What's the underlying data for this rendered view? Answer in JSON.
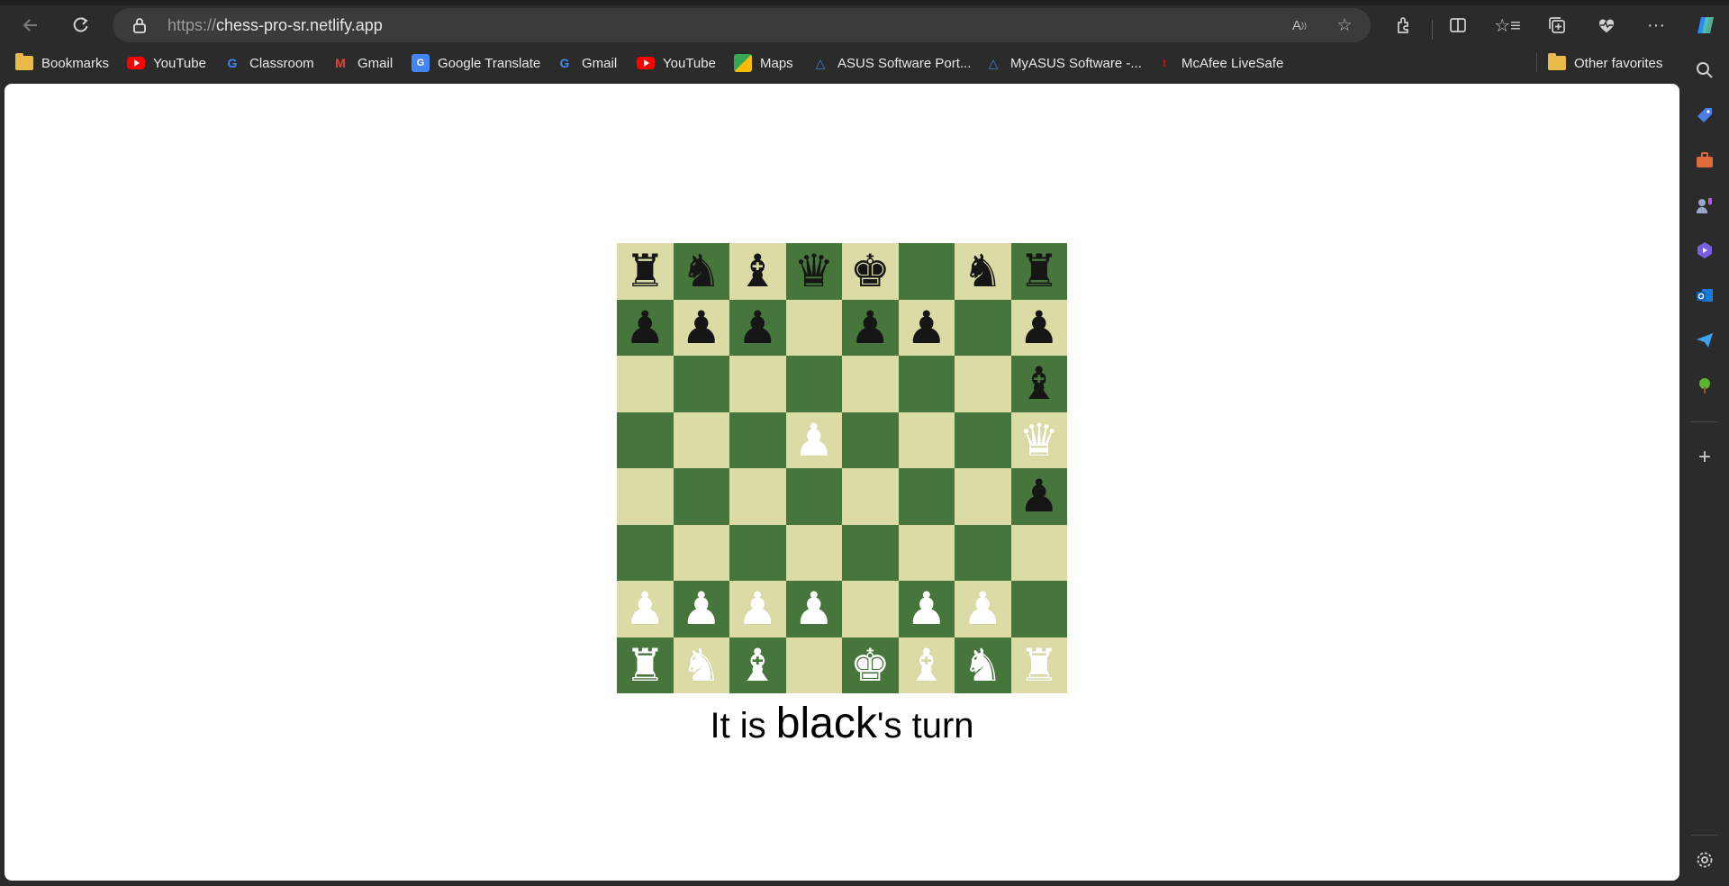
{
  "browser": {
    "url_protocol": "https://",
    "url_host": "chess-pro-sr.netlify.app"
  },
  "bookmarks": [
    {
      "label": "Bookmarks",
      "icon": "folder-icon"
    },
    {
      "label": "YouTube",
      "icon": "youtube-icon"
    },
    {
      "label": "Classroom",
      "icon": "google-icon"
    },
    {
      "label": "Gmail",
      "icon": "gmail-icon"
    },
    {
      "label": "Google Translate",
      "icon": "translate-icon"
    },
    {
      "label": "Gmail",
      "icon": "google-icon"
    },
    {
      "label": "YouTube",
      "icon": "youtube-icon"
    },
    {
      "label": "Maps",
      "icon": "maps-icon"
    },
    {
      "label": "ASUS Software Port...",
      "icon": "asus-icon"
    },
    {
      "label": "MyASUS Software -...",
      "icon": "asus-icon"
    },
    {
      "label": "McAfee LiveSafe",
      "icon": "mcafee-icon"
    }
  ],
  "other_favorites": "Other favorites",
  "board": {
    "ranks": [
      [
        "♜",
        "♞",
        "♝",
        "♛",
        "♚",
        "",
        "♞",
        "♜"
      ],
      [
        "♟",
        "♟",
        "♟",
        "",
        "♟",
        "♟",
        "",
        "♟"
      ],
      [
        "",
        "",
        "",
        "",
        "",
        "",
        "",
        "♝"
      ],
      [
        "",
        "",
        "",
        "♙",
        "",
        "",
        "",
        "♕"
      ],
      [
        "",
        "",
        "",
        "",
        "",
        "",
        "",
        "♟"
      ],
      [
        "",
        "",
        "",
        "",
        "",
        "",
        "",
        ""
      ],
      [
        "♙",
        "♙",
        "♙",
        "♙",
        "",
        "♙",
        "♙",
        ""
      ],
      [
        "♖",
        "♘",
        "♗",
        "",
        "♔",
        "♗",
        "♘",
        "♖"
      ]
    ],
    "colors": [
      [
        "b",
        "b",
        "b",
        "b",
        "b",
        "",
        "b",
        "b"
      ],
      [
        "b",
        "b",
        "b",
        "",
        "b",
        "b",
        "",
        "b"
      ],
      [
        "",
        "",
        "",
        "",
        "",
        "",
        "",
        "b"
      ],
      [
        "",
        "",
        "",
        "w",
        "",
        "",
        "",
        "w"
      ],
      [
        "",
        "",
        "",
        "",
        "",
        "",
        "",
        "b"
      ],
      [
        "",
        "",
        "",
        "",
        "",
        "",
        "",
        ""
      ],
      [
        "w",
        "w",
        "w",
        "w",
        "",
        "w",
        "w",
        ""
      ],
      [
        "w",
        "w",
        "w",
        "",
        "w",
        "w",
        "w",
        "w"
      ]
    ],
    "light_color": "#dcdba5",
    "dark_color": "#46763b"
  },
  "status": {
    "prefix": "It is ",
    "player": "black",
    "suffix": "'s turn"
  }
}
